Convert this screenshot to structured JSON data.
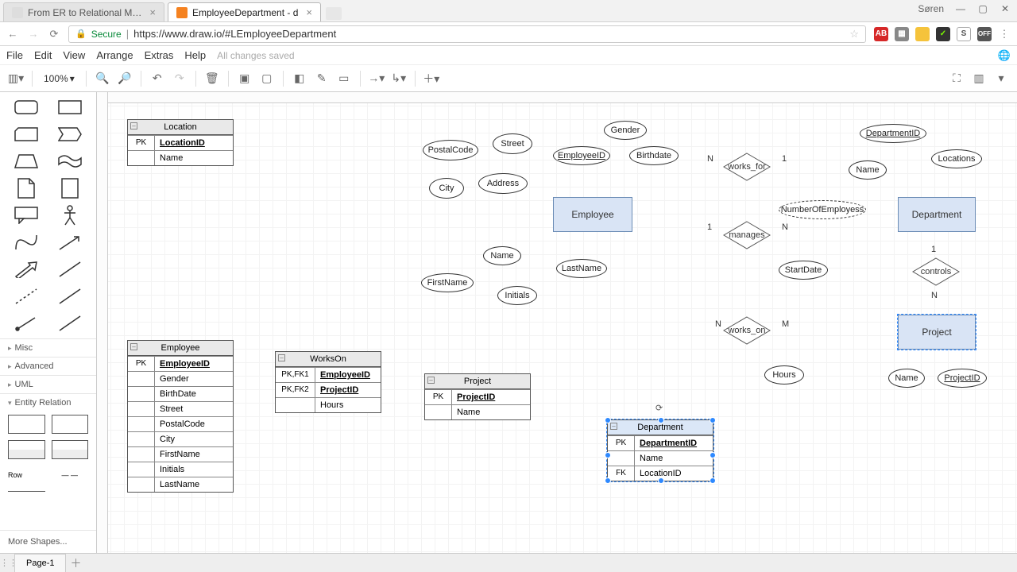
{
  "browser": {
    "tabs": [
      {
        "title": "From ER to Relational M…",
        "active": false
      },
      {
        "title": "EmployeeDepartment - d",
        "active": true
      }
    ],
    "user": "Søren",
    "secure": "Secure",
    "url": "https://www.draw.io/#LEmployeeDepartment"
  },
  "menu": {
    "items": [
      "File",
      "Edit",
      "View",
      "Arrange",
      "Extras",
      "Help"
    ],
    "status": "All changes saved"
  },
  "toolbar": {
    "zoom": "100%"
  },
  "sidebar": {
    "sections": [
      "Misc",
      "Advanced",
      "UML",
      "Entity Relation"
    ],
    "row_label": "Row",
    "more": "More Shapes..."
  },
  "pages": {
    "active": "Page-1"
  },
  "er": {
    "entities": {
      "employee": "Employee",
      "department": "Department",
      "project": "Project"
    },
    "attrs": {
      "postalcode": "PostalCode",
      "street": "Street",
      "city": "City",
      "address": "Address",
      "employeeid": "EmployeeID",
      "gender": "Gender",
      "birthdate": "Birthdate",
      "name_emp": "Name",
      "firstname": "FirstName",
      "lastname": "LastName",
      "initials": "Initials",
      "departmentid": "DepartmentID",
      "locations": "Locations",
      "name_dept": "Name",
      "numemp": "NumberOfEmployess",
      "startdate": "StartDate",
      "hours": "Hours",
      "name_proj": "Name",
      "projectid": "ProjectID"
    },
    "rels": {
      "works_for": "works_for",
      "manages": "manages",
      "works_on": "works_on",
      "controls": "controls"
    },
    "card": {
      "n": "N",
      "one": "1",
      "m": "M"
    }
  },
  "tables": {
    "location": {
      "title": "Location",
      "rows": [
        {
          "k": "PK",
          "v": "LocationID",
          "pk": true
        },
        {
          "k": "",
          "v": "Name"
        }
      ]
    },
    "employee": {
      "title": "Employee",
      "rows": [
        {
          "k": "PK",
          "v": "EmployeeID",
          "pk": true
        },
        {
          "k": "",
          "v": "Gender"
        },
        {
          "k": "",
          "v": "BirthDate"
        },
        {
          "k": "",
          "v": "Street"
        },
        {
          "k": "",
          "v": "PostalCode"
        },
        {
          "k": "",
          "v": "City"
        },
        {
          "k": "",
          "v": "FirstName"
        },
        {
          "k": "",
          "v": "Initials"
        },
        {
          "k": "",
          "v": "LastName"
        }
      ]
    },
    "workson": {
      "title": "WorksOn",
      "rows": [
        {
          "k": "PK,FK1",
          "v": "EmployeeID",
          "pk": true
        },
        {
          "k": "PK,FK2",
          "v": "ProjectID",
          "pk": true
        },
        {
          "k": "",
          "v": "Hours"
        }
      ]
    },
    "project": {
      "title": "Project",
      "rows": [
        {
          "k": "PK",
          "v": "ProjectID",
          "pk": true
        },
        {
          "k": "",
          "v": "Name"
        }
      ]
    },
    "department": {
      "title": "Department",
      "rows": [
        {
          "k": "PK",
          "v": "DepartmentID",
          "pk": true
        },
        {
          "k": "",
          "v": "Name"
        },
        {
          "k": "FK",
          "v": "LocationID"
        }
      ]
    }
  }
}
